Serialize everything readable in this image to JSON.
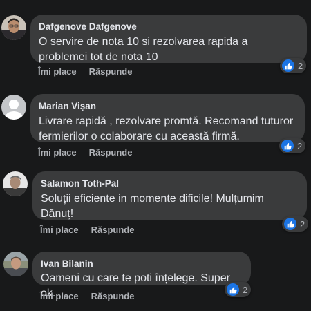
{
  "comments": [
    {
      "author": "Dafgenove Dafgenove",
      "text": "O servire de nota 10 si rezolvarea rapida a problemei tot de nota 10",
      "like_label": "Îmi place",
      "reply_label": "Răspunde",
      "reaction_count": "2",
      "avatar": "profile-photo"
    },
    {
      "author": "Marian Vișan",
      "text": "Livrare rapidă , rezolvare promtă. Recomand tuturor fermierilor o colaborare cu această firmă.",
      "like_label": "Îmi place",
      "reply_label": "Răspunde",
      "reaction_count": "2",
      "avatar": "default-avatar"
    },
    {
      "author": "Salamon Toth-Pal",
      "text": "Soluții eficiente in momente dificile! Mulțumim Dănuț!",
      "like_label": "Îmi place",
      "reply_label": "Răspunde",
      "reaction_count": "2",
      "avatar": "profile-photo"
    },
    {
      "author": "Ivan Bilanin",
      "text": "Oameni cu care te poti înțelege. Super ok.",
      "like_label": "Îmi place",
      "reply_label": "Răspunde",
      "reaction_count": "2",
      "avatar": "profile-photo"
    }
  ],
  "colors": {
    "background": "#18191a",
    "bubble": "#3a3b3c",
    "text": "#e4e6eb",
    "secondary_text": "#b0b3b8",
    "like_blue": "#1b74e4"
  },
  "icons": {
    "reaction": "thumbs-up-icon"
  }
}
